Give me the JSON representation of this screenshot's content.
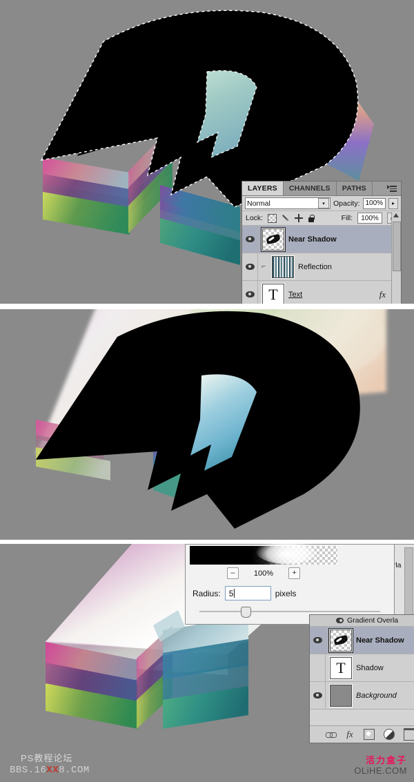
{
  "app": "Adobe Photoshop",
  "panels": {
    "top": {
      "name": "artwork-with-marching-ants-selection"
    },
    "middle": {
      "name": "artwork-blurred-shadow"
    },
    "bottom": {
      "name": "artwork-with-gaussian-blur-dialog"
    }
  },
  "layers_panel_top": {
    "tabs": [
      {
        "label": "LAYERS",
        "active": true
      },
      {
        "label": "CHANNELS",
        "active": false
      },
      {
        "label": "PATHS",
        "active": false
      }
    ],
    "blend_mode": "Normal",
    "opacity_label": "Opacity:",
    "opacity_value": "100%",
    "fill_label": "Fill:",
    "fill_value": "100%",
    "lock_label": "Lock:",
    "lock_icons": [
      "checkerboard-icon",
      "brush-icon",
      "move-icon",
      "lock-icon"
    ],
    "layers": [
      {
        "name": "Near Shadow",
        "visible": true,
        "selected": true,
        "thumb": "checker-swoosh",
        "style": "bold",
        "fx": false,
        "clipped": false
      },
      {
        "name": "Reflection",
        "visible": true,
        "selected": false,
        "thumb": "stripes",
        "style": "normal",
        "fx": false,
        "clipped": true
      },
      {
        "name": "Text",
        "visible": true,
        "selected": false,
        "thumb": "letter-T",
        "style": "underline",
        "fx": true,
        "clipped": false
      }
    ]
  },
  "blur_dialog": {
    "zoom_value": "100%",
    "zoom_out_label": "–",
    "zoom_in_label": "+",
    "radius_label": "Radius:",
    "radius_value": "5",
    "radius_units": "pixels"
  },
  "layers_panel_bottom": {
    "effect_row": "Gradient Overla",
    "layers": [
      {
        "name": "Near Shadow",
        "visible": true,
        "selected": true,
        "thumb": "checker-swoosh",
        "style": "bold"
      },
      {
        "name": "Shadow",
        "visible": false,
        "selected": false,
        "thumb": "letter-T",
        "style": "normal"
      },
      {
        "name": "Background",
        "visible": true,
        "selected": false,
        "thumb": "gray",
        "style": "italic"
      }
    ],
    "toolbar_icons": [
      "link-icon",
      "fx-icon",
      "layer-mask-icon",
      "adjustment-layer-icon",
      "new-group-icon"
    ]
  },
  "side_palette": {
    "clipped_text": "erla"
  },
  "watermarks": {
    "left_line1": "PS教程论坛",
    "left_line2_pre": "BBS.16",
    "left_line2_mid": "XX",
    "left_line2_post": "8.COM",
    "right_line1": "活力盒子",
    "right_line2": "OLiHE.COM"
  },
  "colors": {
    "canvas": "#8a8a8a",
    "panel_bg": "#d4d4d4",
    "selected_layer": "#a9aebe",
    "letter": "#000000",
    "accent_red": "#e8145a"
  }
}
